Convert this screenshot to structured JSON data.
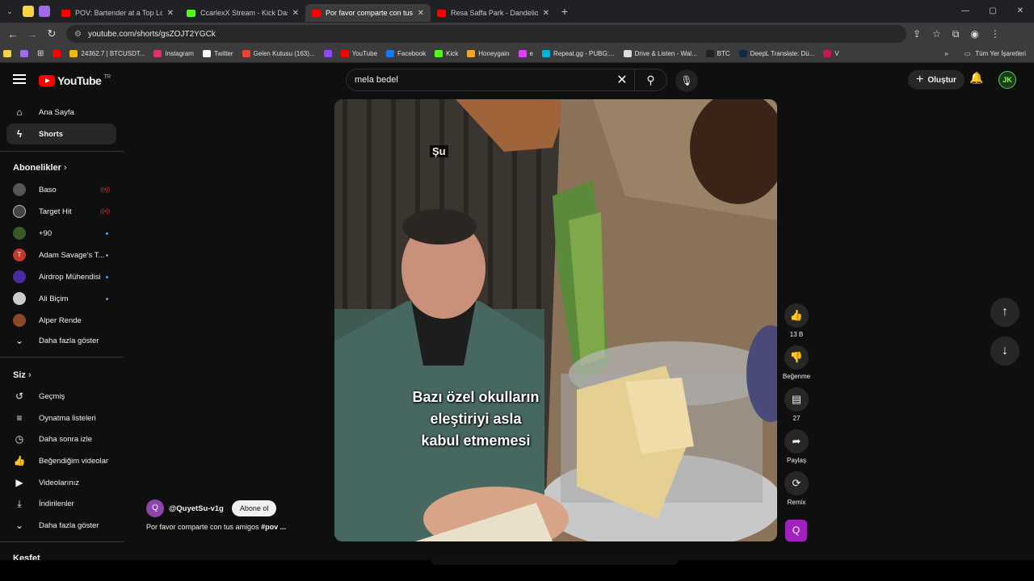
{
  "browser": {
    "tabs": [
      {
        "title": "POV: Bartender at a Top London",
        "favicon_color": "#ff0000"
      },
      {
        "title": "CcarlexX Stream - Kick Das",
        "favicon_color": "#53fc18"
      },
      {
        "title": "Por favor comparte con tus",
        "favicon_color": "#ff0000"
      },
      {
        "title": "Resa Saffa Park - Dandelions (",
        "favicon_color": "#ff0000"
      }
    ],
    "new_tab": "+",
    "url": "youtube.com/shorts/gsZOJT2YGCk",
    "bookmarks": [
      {
        "label": "",
        "color": "#ff0000"
      },
      {
        "label": "24362.7 | BTCUSDT...",
        "color": "#f0b90b"
      },
      {
        "label": "Instagram",
        "color": "#e1306c"
      },
      {
        "label": "Twitter",
        "color": "#ffffff"
      },
      {
        "label": "Gelen Kutusu (163)...",
        "color": "#ea4335"
      },
      {
        "label": "",
        "color": "#9146ff"
      },
      {
        "label": "YouTube",
        "color": "#ff0000"
      },
      {
        "label": "Facebook",
        "color": "#1877f2"
      },
      {
        "label": "Kick",
        "color": "#53fc18"
      },
      {
        "label": "Honeygain",
        "color": "#f5a623"
      },
      {
        "label": "e",
        "color": "#e040fb"
      },
      {
        "label": "Repeat.gg - PUBG:...",
        "color": "#00b4d8"
      },
      {
        "label": "Drive & Listen - Wal...",
        "color": "#dddddd"
      },
      {
        "label": "BTC",
        "color": "#222222"
      },
      {
        "label": "DeepL Translate: Dü...",
        "color": "#0f2b46"
      },
      {
        "label": "V",
        "color": "#c2185b"
      }
    ],
    "all_bookmarks": "Tüm Yer İşaretleri"
  },
  "header": {
    "logo": "YouTube",
    "country": "TR",
    "search_value": "mela bedel",
    "create_label": "Oluştur"
  },
  "sidebar": {
    "main": [
      {
        "label": "Ana Sayfa",
        "icon": "home-icon"
      },
      {
        "label": "Shorts",
        "icon": "shorts-icon"
      }
    ],
    "subs_title": "Abonelikler",
    "subs": [
      {
        "label": "Baso",
        "color": "#555555",
        "live": true
      },
      {
        "label": "Target Hit",
        "color": "#444444",
        "live": true
      },
      {
        "label": "+90",
        "color": "#3a5a2a",
        "dot": true
      },
      {
        "label": "Adam Savage's T...",
        "color": "#c0392b",
        "dot": true
      },
      {
        "label": "Airdrop Mühendisi",
        "color": "#4a2aa0",
        "dot": true
      },
      {
        "label": "Ali Biçim",
        "color": "#cccccc",
        "dot": true
      },
      {
        "label": "Alper Rende",
        "color": "#8a4a2a"
      }
    ],
    "subs_more": "Daha fazla göster",
    "you_title": "Siz",
    "you": [
      {
        "label": "Geçmiş",
        "icon": "history-icon"
      },
      {
        "label": "Oynatma listeleri",
        "icon": "playlists-icon"
      },
      {
        "label": "Daha sonra izle",
        "icon": "watch-later-icon"
      },
      {
        "label": "Beğendiğim videolar",
        "icon": "liked-videos-icon"
      },
      {
        "label": "Videolarınız",
        "icon": "your-videos-icon"
      },
      {
        "label": "İndirilenler",
        "icon": "downloads-icon"
      }
    ],
    "you_more": "Daha fazla göster",
    "explore_title": "Keşfet"
  },
  "short": {
    "subtitle_word": "Şu",
    "caption_lines": [
      "Bazı özel okulların",
      "eleştiriyi asla",
      "kabul etmemesi"
    ],
    "channel": "@QuyetSu-v1g",
    "channel_initial": "Q",
    "subscribe_label": "Abone ol",
    "description": "Por favor comparte con tus amigos ",
    "description_tag": "#pov ..."
  },
  "actions": {
    "like_count": "13 B",
    "dislike_label": "Beğenme",
    "comment_count": "27",
    "share_label": "Paylaş",
    "remix_label": "Remix",
    "remix_initial": "Q"
  }
}
